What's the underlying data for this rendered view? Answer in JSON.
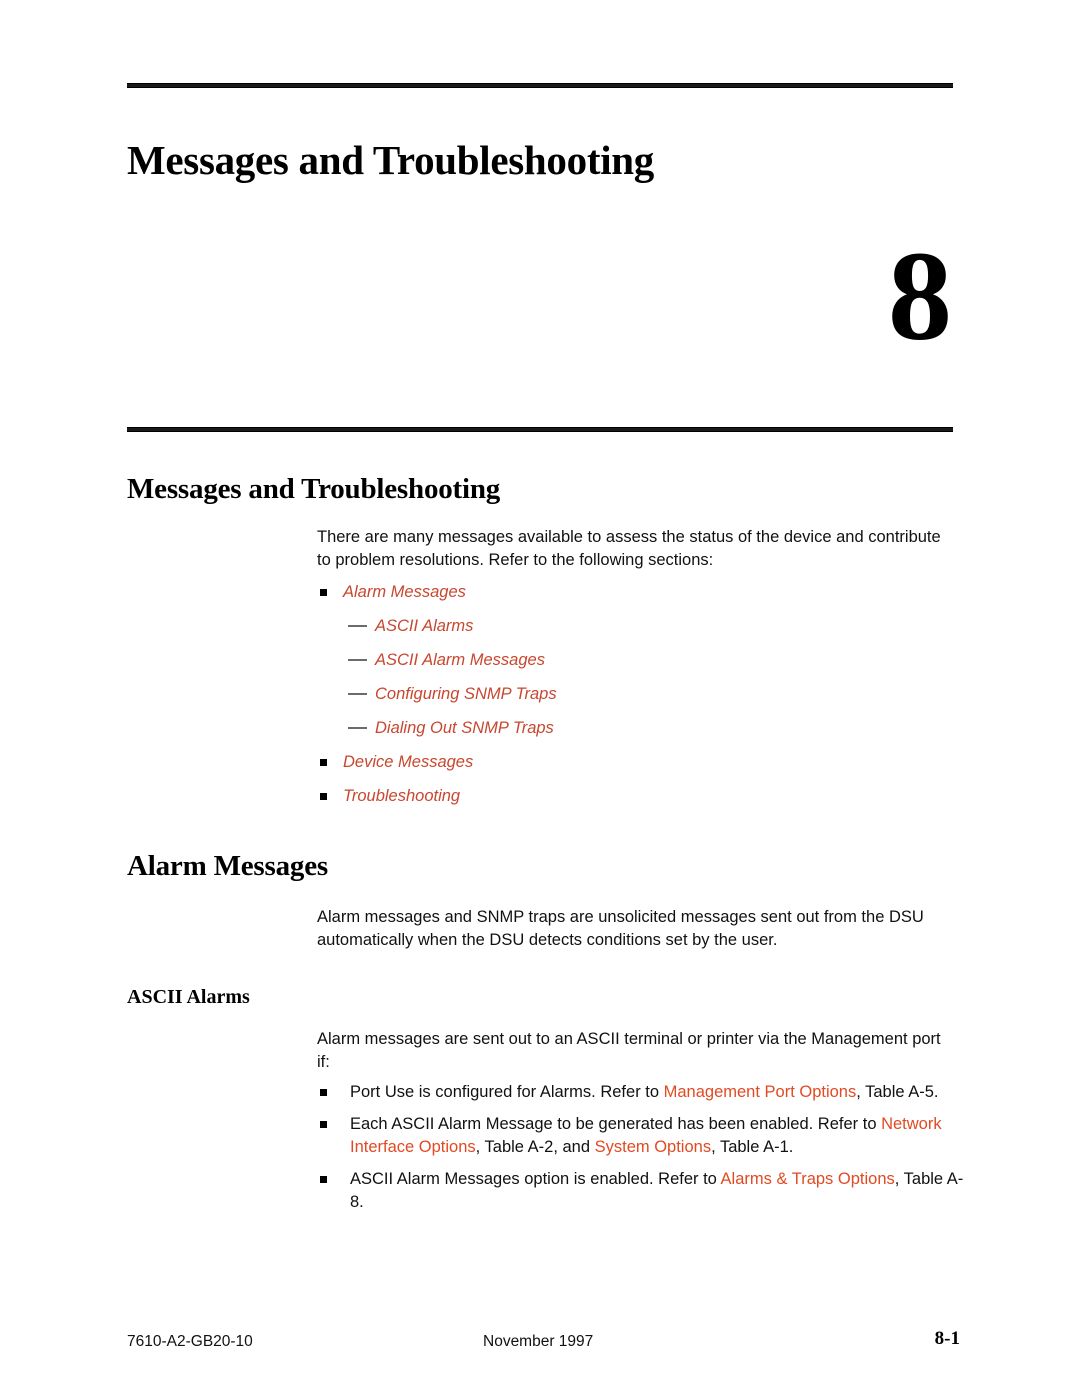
{
  "chapter": {
    "title": "Messages and Troubleshooting",
    "number": "8"
  },
  "sections": {
    "intro_heading": "Messages and Troubleshooting",
    "intro_paragraph": "There are many messages available to assess the status of the device and contribute to problem resolutions. Refer to the following sections:",
    "alarm_heading": "Alarm Messages",
    "alarm_paragraph": "Alarm messages and SNMP traps are unsolicited messages sent out from the DSU automatically when the DSU detects conditions set by the user.",
    "ascii_heading": "ASCII Alarms",
    "ascii_paragraph": "Alarm messages are sent out to an ASCII terminal or printer via the Management port if:"
  },
  "cross_references": [
    {
      "level": 1,
      "label": "Alarm Messages"
    },
    {
      "level": 2,
      "label": "ASCII Alarms"
    },
    {
      "level": 2,
      "label": "ASCII Alarm Messages"
    },
    {
      "level": 2,
      "label": "Configuring SNMP Traps"
    },
    {
      "level": 2,
      "label": "Dialing Out SNMP Traps"
    },
    {
      "level": 1,
      "label": "Device Messages"
    },
    {
      "level": 1,
      "label": "Troubleshooting"
    }
  ],
  "conditions": [
    {
      "parts": [
        {
          "text": "Port Use is configured for Alarms. Refer to ",
          "link": false
        },
        {
          "text": "Management Port Options",
          "link": true
        },
        {
          "text": ", Table A-5.",
          "link": false
        }
      ]
    },
    {
      "parts": [
        {
          "text": "Each ASCII Alarm Message to be generated has been enabled. Refer to ",
          "link": false
        },
        {
          "text": "Network Interface Options",
          "link": true
        },
        {
          "text": ", Table A-2, and ",
          "link": false
        },
        {
          "text": "System Options",
          "link": true
        },
        {
          "text": ", Table A-1.",
          "link": false
        }
      ]
    },
    {
      "parts": [
        {
          "text": "ASCII Alarm Messages option is enabled. Refer to ",
          "link": false
        },
        {
          "text": "Alarms & Traps Options",
          "link": true
        },
        {
          "text": ", Table A-8.",
          "link": false
        }
      ]
    }
  ],
  "footer": {
    "document_number": "7610-A2-GB20-10",
    "date": "November 1997",
    "page_number": "8-1"
  },
  "colors": {
    "link_red": "#C8472F",
    "reference_red": "#E24A23",
    "text_black": "#111111",
    "rule_black": "#1a1a1a"
  }
}
